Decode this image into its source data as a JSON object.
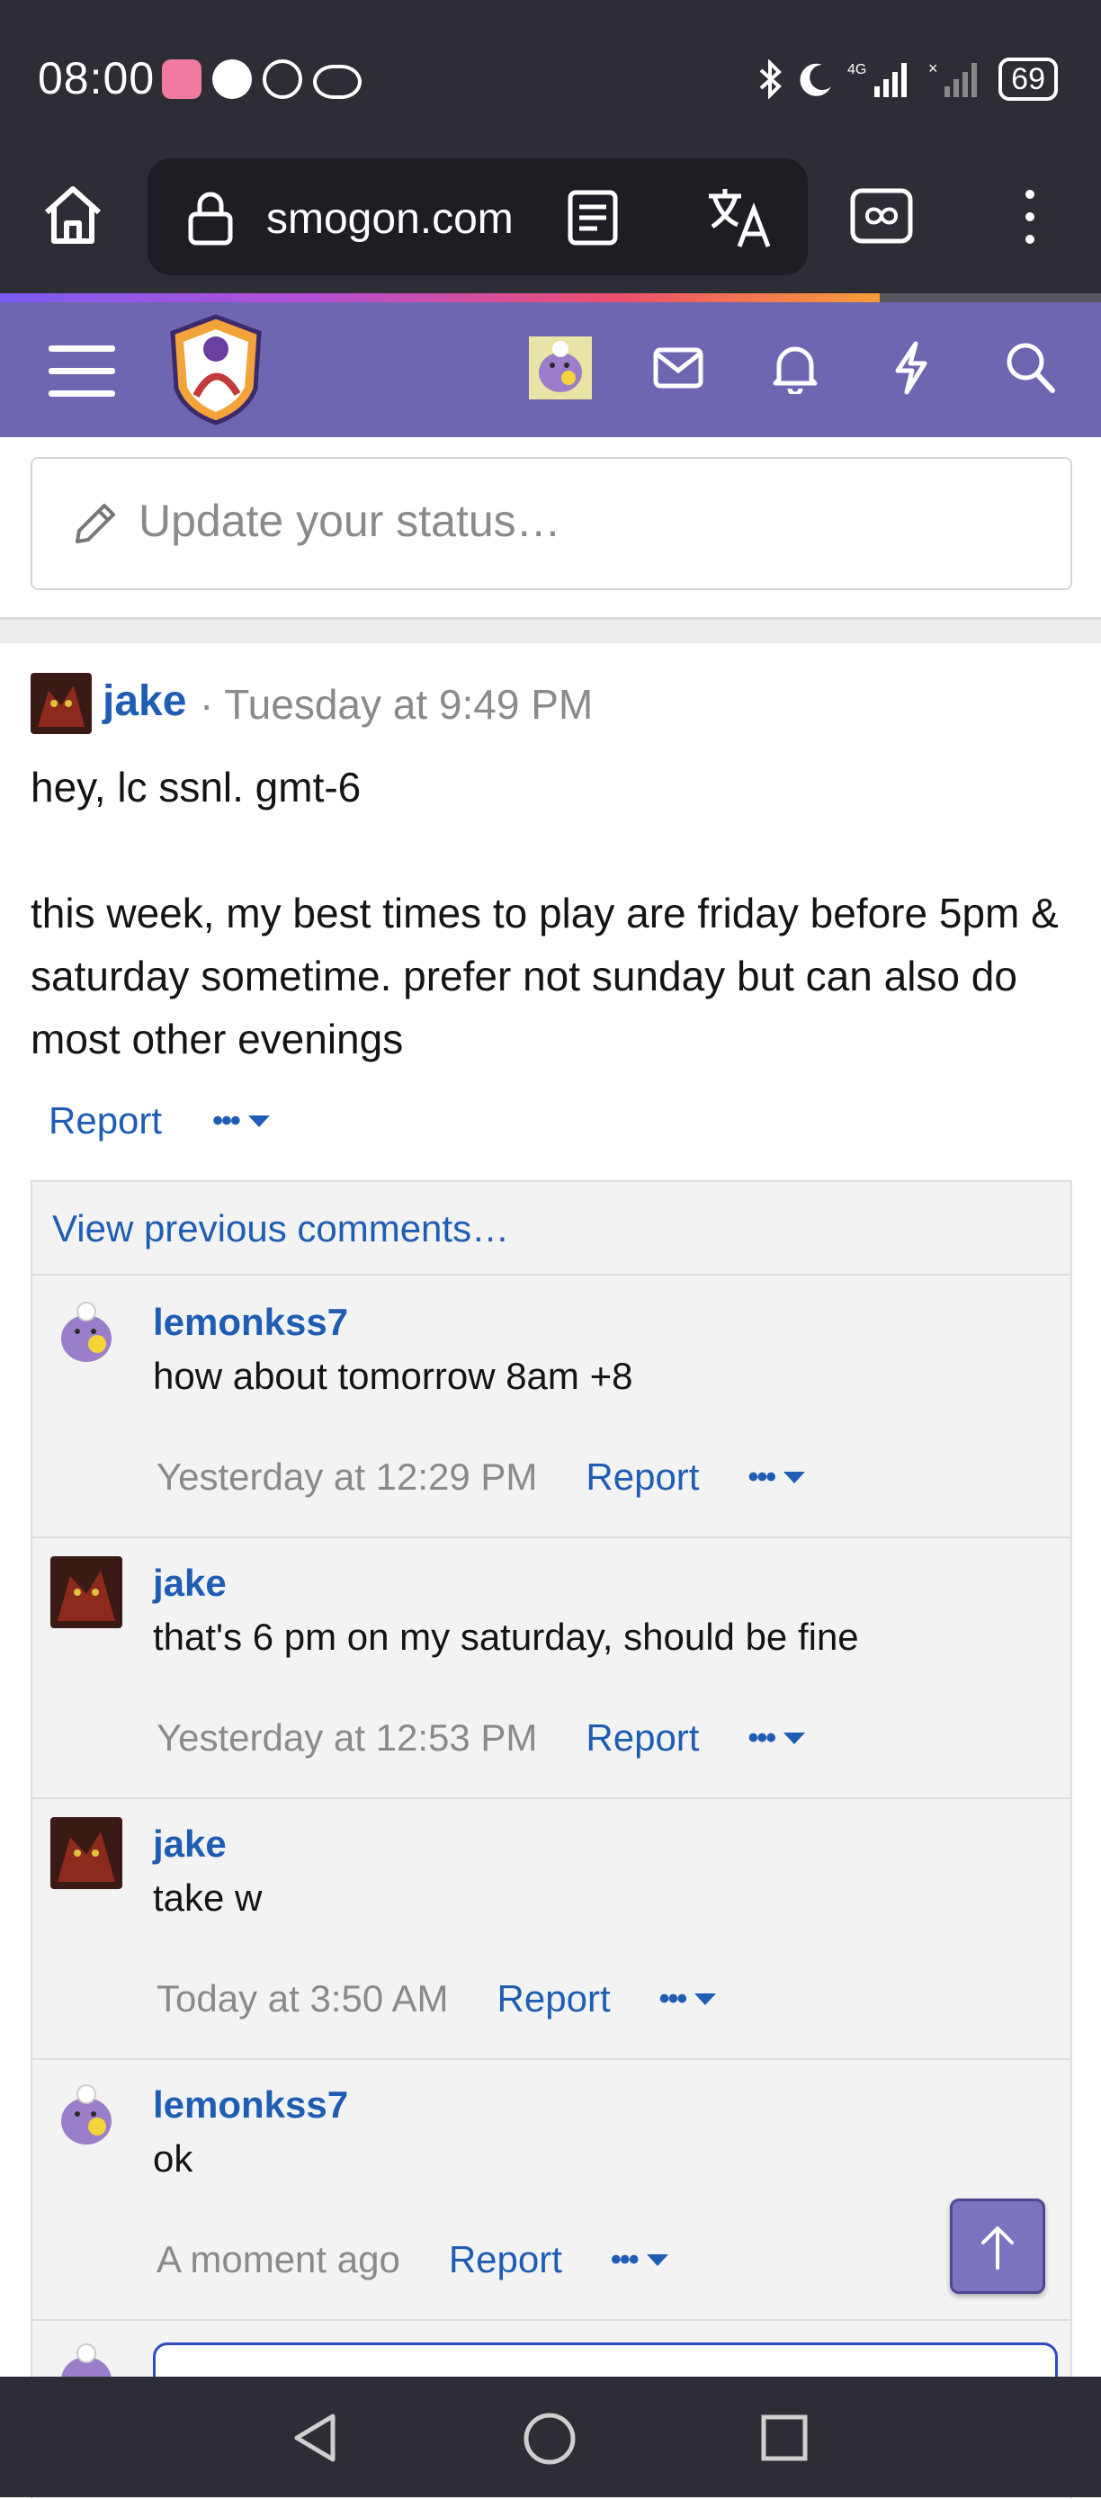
{
  "status_bar": {
    "time": "08:00",
    "battery": "69"
  },
  "browser": {
    "url": "smogon.com"
  },
  "status_update": {
    "placeholder": "Update your status…"
  },
  "post": {
    "author": "jake",
    "time": "· Tuesday at 9:49 PM",
    "body_line1": "hey, lc ssnl. gmt-6",
    "body_line2": "this week, my best times to play are friday before 5pm & saturday sometime. prefer not sunday but can also do most other evenings",
    "report_label": "Report"
  },
  "comments": {
    "view_previous": "View previous comments…",
    "items": [
      {
        "author": "lemonkss7",
        "text": "how about tomorrow 8am +8",
        "time": "Yesterday at 12:29 PM",
        "report": "Report"
      },
      {
        "author": "jake",
        "text": "that's 6 pm on my saturday, should be fine",
        "time": "Yesterday at 12:53 PM",
        "report": "Report"
      },
      {
        "author": "jake",
        "text": "take w",
        "time": "Today at 3:50 AM",
        "report": "Report"
      },
      {
        "author": "lemonkss7",
        "text": "ok",
        "time": "A moment ago",
        "report": "Report"
      }
    ]
  },
  "colors": {
    "accent": "#6f66b1",
    "link": "#1f5db4",
    "system_bar": "#2c2d35"
  }
}
